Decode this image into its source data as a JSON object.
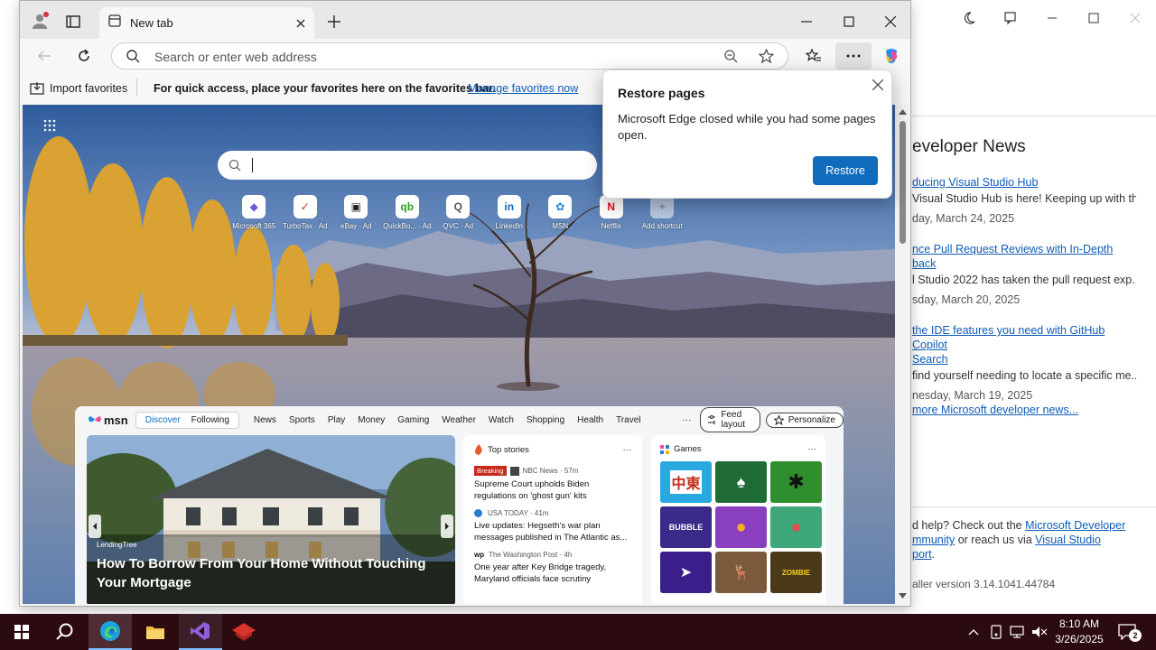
{
  "installer": {
    "news_heading": "eveloper News",
    "news": [
      {
        "link": "ducing Visual Studio Hub",
        "desc": "Visual Studio Hub is here! Keeping up with th...",
        "date": "day, March 24, 2025"
      },
      {
        "link": "nce Pull Request Reviews with In-Depth\nback",
        "desc": "l Studio 2022 has taken the pull request exp...",
        "date": "sday, March 20, 2025"
      },
      {
        "link": " the IDE features you need with GitHub Copilot\nSearch",
        "desc": " find yourself needing to locate a specific me...",
        "date": "nesday, March 19, 2025"
      }
    ],
    "more_news": " more Microsoft developer news...",
    "help_pre": "d help? Check out the ",
    "help_link1": "Microsoft Developer\nmmunity",
    "help_mid": " or reach us via ",
    "help_link2": "Visual Studio\nport",
    "help_end": ".",
    "version": "aller version 3.14.1041.44784"
  },
  "edge": {
    "tab_title": "New tab",
    "address_placeholder": "Search or enter web address",
    "favbar": {
      "import": "Import favorites",
      "message": "For quick access, place your favorites here on the favorites bar.",
      "manage": "Manage favorites now"
    },
    "shortcuts": [
      {
        "label": "Microsoft 365",
        "glyph": "◆",
        "color": "#6b5bd6"
      },
      {
        "label": "TurboTax · Ad",
        "glyph": "✓",
        "color": "#d52b1e"
      },
      {
        "label": "eBay · Ad",
        "glyph": "▣",
        "color": "#222222"
      },
      {
        "label": "QuickBo... · Ad",
        "glyph": "qb",
        "color": "#2ca01c"
      },
      {
        "label": "QVC · Ad",
        "glyph": "Q",
        "color": "#555555"
      },
      {
        "label": "LinkedIn",
        "glyph": "in",
        "color": "#0a66c2"
      },
      {
        "label": "MSN",
        "glyph": "✿",
        "color": "#1f88e5"
      },
      {
        "label": "Netflix",
        "glyph": "N",
        "color": "#e50914"
      },
      {
        "label": "Add shortcut",
        "glyph": "+",
        "color": "#888888"
      }
    ],
    "msn": {
      "logo": "msn",
      "tabs": [
        "Discover",
        "Following"
      ],
      "nav": [
        "News",
        "Sports",
        "Play",
        "Money",
        "Gaming",
        "Weather",
        "Watch",
        "Shopping",
        "Health",
        "Travel"
      ],
      "more": "···",
      "feed_layout": "Feed layout",
      "personalize": "Personalize",
      "hero": {
        "source": "LendingTree",
        "title": "How To Borrow From Your Home Without Touching Your Mortgage"
      },
      "top_stories": {
        "title": "Top stories",
        "more": "···",
        "items": [
          {
            "badge": "Breaking",
            "source": "NBC News · 57m",
            "headline": "Supreme Court upholds Biden regulations on 'ghost gun' kits"
          },
          {
            "badge": "",
            "source": "USA TODAY · 41m",
            "headline": "Live updates: Hegseth's war plan messages published in The Atlantic as..."
          },
          {
            "badge": "",
            "source": "The Washington Post · 4h",
            "headline": "One year after Key Bridge tragedy, Maryland officials face scrutiny"
          }
        ]
      },
      "games": {
        "title": "Games",
        "more": "···",
        "tiles": [
          {
            "name": "mahjong-game-icon",
            "color": "#29a9e0",
            "text": "中東"
          },
          {
            "name": "solitaire-game-icon",
            "color": "#1e6b36",
            "text": "♠"
          },
          {
            "name": "spider-solitaire-game-icon",
            "color": "#2f8f2f",
            "text": "✱"
          },
          {
            "name": "bubble-shooter-game-icon",
            "color": "#3b2a8a",
            "text": "BUBBLE"
          },
          {
            "name": "bubble-game-icon",
            "color": "#8a3fbf",
            "text": "●"
          },
          {
            "name": "bubble-pop-game-icon",
            "color": "#3fa87a",
            "text": "●"
          },
          {
            "name": "arrow-game-icon",
            "color": "#3a1f8a",
            "text": "➤"
          },
          {
            "name": "deer-hunter-game-icon",
            "color": "#7a5a3a",
            "text": "🦌"
          },
          {
            "name": "zombie-sniper-game-icon",
            "color": "#4b3a1a",
            "text": "ZOMBIE"
          }
        ]
      }
    },
    "popup": {
      "title": "Restore pages",
      "message": "Microsoft Edge closed while you had some pages open.",
      "button": "Restore"
    }
  },
  "taskbar": {
    "time": "8:10 AM",
    "date": "3/26/2025",
    "notification_count": "2"
  },
  "colors": {
    "accent": "#0f6cbd",
    "link": "#0f5cb8",
    "taskbar": "#2b0a10"
  }
}
